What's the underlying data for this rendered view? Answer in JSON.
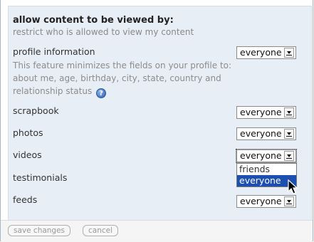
{
  "section": {
    "title": "allow content to be viewed by:",
    "subtitle": "restrict who is allowed to view my content"
  },
  "rows": [
    {
      "label": "profile information",
      "value": "everyone"
    },
    {
      "label": "scrapbook",
      "value": "everyone"
    },
    {
      "label": "photos",
      "value": "everyone"
    },
    {
      "label": "videos",
      "value": "everyone"
    },
    {
      "label": "testimonials",
      "value": ""
    },
    {
      "label": "feeds",
      "value": "everyone"
    }
  ],
  "profile_description": "This feature minimizes the fields on your profile to: about me, age, birthday, city, state, country and relationship status",
  "help_icon_glyph": "?",
  "dropdown": {
    "options": [
      "friends",
      "everyone"
    ],
    "highlighted": "everyone"
  },
  "buttons": {
    "save": "save changes",
    "cancel": "cancel"
  },
  "colors": {
    "section_bg": "#e8eef6",
    "highlight": "#1c4fb0"
  }
}
